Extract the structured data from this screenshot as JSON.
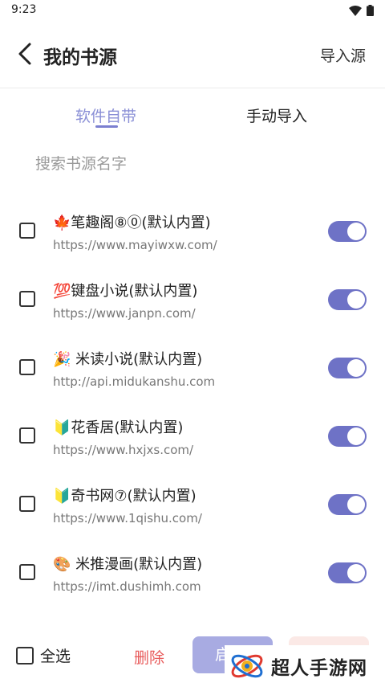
{
  "status_bar": {
    "time": "9:23"
  },
  "header": {
    "title": "我的书源",
    "import_label": "导入源"
  },
  "tabs": [
    {
      "label": "软件自带"
    },
    {
      "label": "手动导入"
    }
  ],
  "search": {
    "placeholder": "搜索书源名字"
  },
  "sources": [
    {
      "name": "🍁笔趣阁⑧⓪(默认内置)",
      "url": "https://www.mayiwxw.com/",
      "enabled": true
    },
    {
      "name": "💯键盘小说(默认内置)",
      "url": "https://www.janpn.com/",
      "enabled": true
    },
    {
      "name": "🎉 米读小说(默认内置)",
      "url": "http://api.midukanshu.com",
      "enabled": true
    },
    {
      "name": "🔰花香居(默认内置)",
      "url": "https://www.hxjxs.com/",
      "enabled": true
    },
    {
      "name": "🔰奇书网⑦(默认内置)",
      "url": "https://www.1qishu.com/",
      "enabled": true
    },
    {
      "name": "🎨 米推漫画(默认内置)",
      "url": "https://imt.dushimh.com",
      "enabled": true
    }
  ],
  "footer": {
    "select_all": "全选",
    "delete": "删除",
    "enable_partial": "启"
  },
  "watermark": {
    "text": "超人手游网"
  },
  "colors": {
    "accent": "#6e72c6",
    "tab_active": "#8a8fd6",
    "delete": "#e85a5a"
  }
}
